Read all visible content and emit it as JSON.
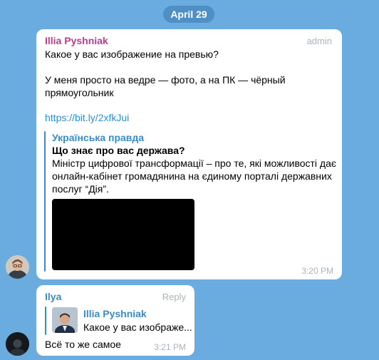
{
  "date_label": "April 29",
  "messages": [
    {
      "sender": "Illia Pyshniak",
      "role_tag": "admin",
      "lines": [
        "Какое у вас изображение на превью?",
        "У меня просто на ведре — фото, а на ПК — чёрный",
        "прямоугольник"
      ],
      "link": "https://bit.ly/2xfkJui",
      "preview": {
        "site": "Українська правда",
        "title": "Що знає про вас держава?",
        "desc_lines": [
          "Міністр цифрової трансформації – про те, які можливості дає",
          "онлайн-кабінет громадянина на єдиному порталі державних",
          "послуг “Дія”."
        ]
      },
      "time": "3:20 PM"
    },
    {
      "sender": "Ilya",
      "reply_label": "Reply",
      "quote": {
        "name": "Illia Pyshniak",
        "text": "Какое у вас изображе..."
      },
      "text": "Всё то же самое",
      "time": "3:21 PM"
    }
  ],
  "colors": {
    "background": "#6aace0",
    "date_pill": "#4f8fc6",
    "admin_name": "#c03d8c",
    "user_name": "#3a8bc7",
    "link": "#2d8ed8"
  }
}
